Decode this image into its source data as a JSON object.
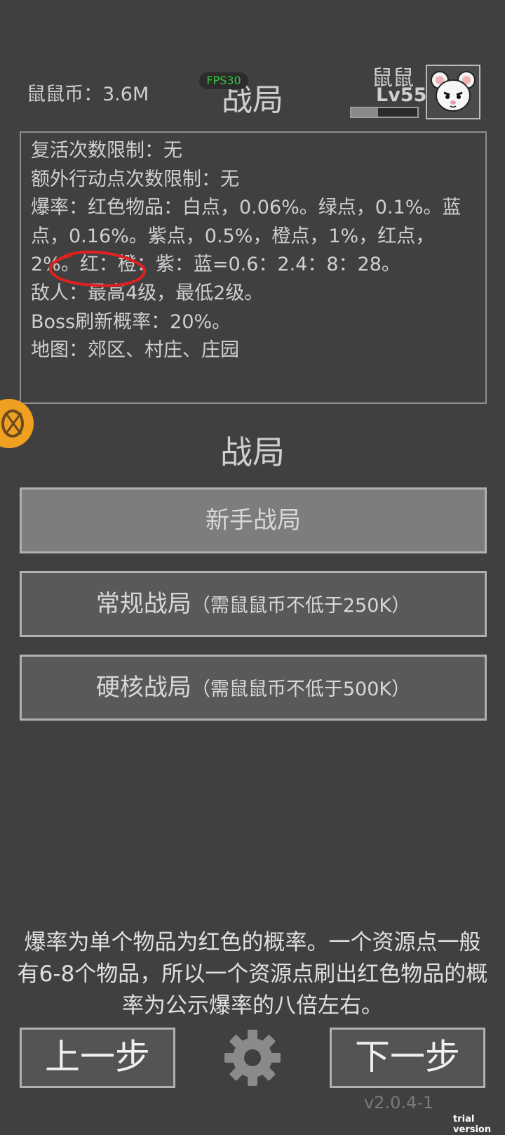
{
  "header": {
    "coins": "鼠鼠币：3.6M",
    "fps": "FPS30",
    "title": "战局",
    "user_name": "鼠鼠",
    "user_level": "Lv55",
    "xp_progress": 0.4
  },
  "info_lines": [
    "复活次数限制：无",
    "额外行动点次数限制：无",
    "爆率：红色物品：白点，0.06%。绿点，0.1%。蓝点，0.16%。紫点，0.5%，橙点，1%，红点，2%。红：橙：紫：蓝=0.6：2.4：8：28。",
    "敌人：最高4级，最低2级。",
    "Boss刷新概率：20%。",
    "地图：郊区、村庄、庄园"
  ],
  "section_title": "战局",
  "modes": [
    {
      "label": "新手战局",
      "note": ""
    },
    {
      "label": "常规战局",
      "note": "（需鼠鼠币不低于250K）"
    },
    {
      "label": "硬核战局",
      "note": "（需鼠鼠币不低于500K）"
    }
  ],
  "tip": "爆率为单个物品为红色的概率。一个资源点一般有6-8个物品，所以一个资源点刷出红色物品的概率为公示爆率的八倍左右。",
  "nav": {
    "prev": "上一步",
    "next": "下一步"
  },
  "version": "v2.0.4-1",
  "watermark": "trial version",
  "colors": {
    "background": "#404040",
    "fps": "#37c43c",
    "annotation": "#e02020",
    "side_icon": "#f0a020"
  }
}
